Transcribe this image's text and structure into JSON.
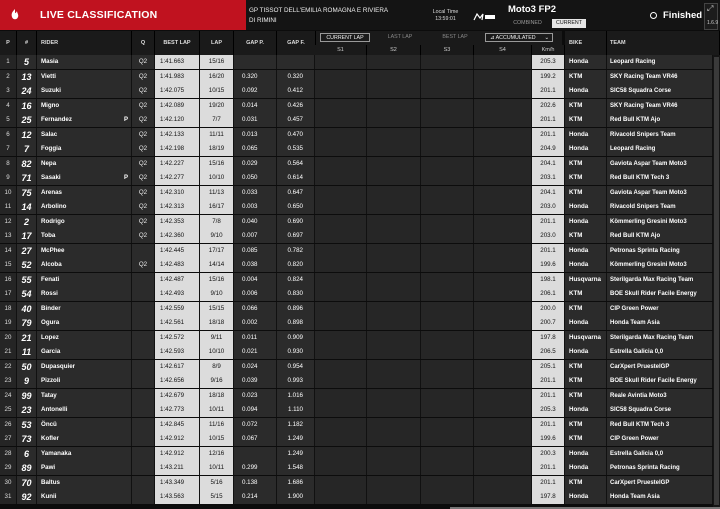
{
  "header": {
    "title": "LIVE CLASSIFICATION",
    "event": "GP TISSOT DELL'EMILIA ROMAGNA E RIVIERA DI RIMINI",
    "local_time_label": "Local Time",
    "local_time": "13:59:01",
    "class_name": "Moto3 FP2",
    "tab_combined": "COMBINED",
    "tab_current": "CURRENT",
    "status": "Finished",
    "version": "1.6.9",
    "colors": {
      "accent": "#c0121f"
    }
  },
  "columns": {
    "pos": "P",
    "num": "#",
    "rider": "RIDER",
    "q": "Q",
    "best_lap": "BEST LAP",
    "lap": "LAP",
    "gap_p": "GAP P.",
    "gap_f": "GAP F.",
    "s1": "S1",
    "s2": "S2",
    "s3": "S3",
    "s4": "S4",
    "speed": "Km/h",
    "bike": "BIKE",
    "team": "TEAM"
  },
  "sector_tabs": {
    "current_lap": "CURRENT LAP",
    "last_lap": "LAST LAP",
    "best_lap": "BEST LAP",
    "accumulated": "ACCUMULATED"
  },
  "rows": [
    {
      "pos": "1",
      "num": "5",
      "rider": "Masia",
      "pit": "",
      "q": "Q2",
      "best": "1:41.663",
      "lap": "15/16",
      "gap_p": "",
      "gap_f": "",
      "spd": "205.3",
      "bike": "Honda",
      "team": "Leopard Racing"
    },
    {
      "pos": "2",
      "num": "13",
      "rider": "Vietti",
      "pit": "",
      "q": "Q2",
      "best": "1:41.983",
      "lap": "16/20",
      "gap_p": "0.320",
      "gap_f": "0.320",
      "spd": "199.2",
      "bike": "KTM",
      "team": "SKY Racing Team VR46"
    },
    {
      "pos": "3",
      "num": "24",
      "rider": "Suzuki",
      "pit": "",
      "q": "Q2",
      "best": "1:42.075",
      "lap": "10/15",
      "gap_p": "0.092",
      "gap_f": "0.412",
      "spd": "201.1",
      "bike": "Honda",
      "team": "SIC58 Squadra Corse"
    },
    {
      "pos": "4",
      "num": "16",
      "rider": "Migno",
      "pit": "",
      "q": "Q2",
      "best": "1:42.089",
      "lap": "19/20",
      "gap_p": "0.014",
      "gap_f": "0.426",
      "spd": "202.6",
      "bike": "KTM",
      "team": "SKY Racing Team VR46"
    },
    {
      "pos": "5",
      "num": "25",
      "rider": "Fernandez",
      "pit": "P",
      "q": "Q2",
      "best": "1:42.120",
      "lap": "7/7",
      "gap_p": "0.031",
      "gap_f": "0.457",
      "spd": "201.1",
      "bike": "KTM",
      "team": "Red Bull KTM Ajo"
    },
    {
      "pos": "6",
      "num": "12",
      "rider": "Salac",
      "pit": "",
      "q": "Q2",
      "best": "1:42.133",
      "lap": "11/11",
      "gap_p": "0.013",
      "gap_f": "0.470",
      "spd": "201.1",
      "bike": "Honda",
      "team": "Rivacold Snipers Team"
    },
    {
      "pos": "7",
      "num": "7",
      "rider": "Foggia",
      "pit": "",
      "q": "Q2",
      "best": "1:42.198",
      "lap": "18/19",
      "gap_p": "0.065",
      "gap_f": "0.535",
      "spd": "204.9",
      "bike": "Honda",
      "team": "Leopard Racing"
    },
    {
      "pos": "8",
      "num": "82",
      "rider": "Nepa",
      "pit": "",
      "q": "Q2",
      "best": "1:42.227",
      "lap": "15/16",
      "gap_p": "0.029",
      "gap_f": "0.564",
      "spd": "204.1",
      "bike": "KTM",
      "team": "Gaviota Aspar Team Moto3"
    },
    {
      "pos": "9",
      "num": "71",
      "rider": "Sasaki",
      "pit": "P",
      "q": "Q2",
      "best": "1:42.277",
      "lap": "10/10",
      "gap_p": "0.050",
      "gap_f": "0.614",
      "spd": "203.1",
      "bike": "KTM",
      "team": "Red Bull KTM Tech 3"
    },
    {
      "pos": "10",
      "num": "75",
      "rider": "Arenas",
      "pit": "",
      "q": "Q2",
      "best": "1:42.310",
      "lap": "11/13",
      "gap_p": "0.033",
      "gap_f": "0.647",
      "spd": "204.1",
      "bike": "KTM",
      "team": "Gaviota Aspar Team Moto3"
    },
    {
      "pos": "11",
      "num": "14",
      "rider": "Arbolino",
      "pit": "",
      "q": "Q2",
      "best": "1:42.313",
      "lap": "16/17",
      "gap_p": "0.003",
      "gap_f": "0.650",
      "spd": "203.0",
      "bike": "Honda",
      "team": "Rivacold Snipers Team"
    },
    {
      "pos": "12",
      "num": "2",
      "rider": "Rodrigo",
      "pit": "",
      "q": "Q2",
      "best": "1:42.353",
      "lap": "7/8",
      "gap_p": "0.040",
      "gap_f": "0.690",
      "spd": "201.1",
      "bike": "Honda",
      "team": "Kömmerling Gresini Moto3"
    },
    {
      "pos": "13",
      "num": "17",
      "rider": "Toba",
      "pit": "",
      "q": "Q2",
      "best": "1:42.360",
      "lap": "9/10",
      "gap_p": "0.007",
      "gap_f": "0.697",
      "spd": "203.0",
      "bike": "KTM",
      "team": "Red Bull KTM Ajo"
    },
    {
      "pos": "14",
      "num": "27",
      "rider": "McPhee",
      "pit": "",
      "q": "",
      "best": "1:42.445",
      "lap": "17/17",
      "gap_p": "0.085",
      "gap_f": "0.782",
      "spd": "201.1",
      "bike": "Honda",
      "team": "Petronas Sprinta Racing"
    },
    {
      "pos": "15",
      "num": "52",
      "rider": "Alcoba",
      "pit": "",
      "q": "Q2",
      "best": "1:42.483",
      "lap": "14/14",
      "gap_p": "0.038",
      "gap_f": "0.820",
      "spd": "199.6",
      "bike": "Honda",
      "team": "Kömmerling Gresini Moto3"
    },
    {
      "pos": "16",
      "num": "55",
      "rider": "Fenati",
      "pit": "",
      "q": "",
      "best": "1:42.487",
      "lap": "15/16",
      "gap_p": "0.004",
      "gap_f": "0.824",
      "spd": "198.1",
      "bike": "Husqvarna",
      "team": "Sterilgarda Max Racing Team"
    },
    {
      "pos": "17",
      "num": "54",
      "rider": "Rossi",
      "pit": "",
      "q": "",
      "best": "1:42.493",
      "lap": "9/10",
      "gap_p": "0.006",
      "gap_f": "0.830",
      "spd": "206.1",
      "bike": "KTM",
      "team": "BOE Skull Rider Facile Energy"
    },
    {
      "pos": "18",
      "num": "40",
      "rider": "Binder",
      "pit": "",
      "q": "",
      "best": "1:42.559",
      "lap": "15/15",
      "gap_p": "0.066",
      "gap_f": "0.896",
      "spd": "200.0",
      "bike": "KTM",
      "team": "CIP Green Power"
    },
    {
      "pos": "19",
      "num": "79",
      "rider": "Ogura",
      "pit": "",
      "q": "",
      "best": "1:42.561",
      "lap": "18/18",
      "gap_p": "0.002",
      "gap_f": "0.898",
      "spd": "200.7",
      "bike": "Honda",
      "team": "Honda Team Asia"
    },
    {
      "pos": "20",
      "num": "21",
      "rider": "Lopez",
      "pit": "",
      "q": "",
      "best": "1:42.572",
      "lap": "9/11",
      "gap_p": "0.011",
      "gap_f": "0.909",
      "spd": "197.8",
      "bike": "Husqvarna",
      "team": "Sterilgarda Max Racing Team"
    },
    {
      "pos": "21",
      "num": "11",
      "rider": "Garcia",
      "pit": "",
      "q": "",
      "best": "1:42.593",
      "lap": "10/10",
      "gap_p": "0.021",
      "gap_f": "0.930",
      "spd": "206.5",
      "bike": "Honda",
      "team": "Estrella Galicia 0,0"
    },
    {
      "pos": "22",
      "num": "50",
      "rider": "Dupasquier",
      "pit": "",
      "q": "",
      "best": "1:42.617",
      "lap": "8/9",
      "gap_p": "0.024",
      "gap_f": "0.954",
      "spd": "205.1",
      "bike": "KTM",
      "team": "CarXpert PruestelGP"
    },
    {
      "pos": "23",
      "num": "9",
      "rider": "Pizzoli",
      "pit": "",
      "q": "",
      "best": "1:42.656",
      "lap": "9/16",
      "gap_p": "0.039",
      "gap_f": "0.993",
      "spd": "201.1",
      "bike": "KTM",
      "team": "BOE Skull Rider Facile Energy"
    },
    {
      "pos": "24",
      "num": "99",
      "rider": "Tatay",
      "pit": "",
      "q": "",
      "best": "1:42.679",
      "lap": "18/18",
      "gap_p": "0.023",
      "gap_f": "1.016",
      "spd": "201.1",
      "bike": "KTM",
      "team": "Reale Avintia Moto3"
    },
    {
      "pos": "25",
      "num": "23",
      "rider": "Antonelli",
      "pit": "",
      "q": "",
      "best": "1:42.773",
      "lap": "10/11",
      "gap_p": "0.094",
      "gap_f": "1.110",
      "spd": "205.3",
      "bike": "Honda",
      "team": "SIC58 Squadra Corse"
    },
    {
      "pos": "26",
      "num": "53",
      "rider": "Öncü",
      "pit": "",
      "q": "",
      "best": "1:42.845",
      "lap": "11/16",
      "gap_p": "0.072",
      "gap_f": "1.182",
      "spd": "201.1",
      "bike": "KTM",
      "team": "Red Bull KTM Tech 3"
    },
    {
      "pos": "27",
      "num": "73",
      "rider": "Kofler",
      "pit": "",
      "q": "",
      "best": "1:42.912",
      "lap": "10/15",
      "gap_p": "0.067",
      "gap_f": "1.249",
      "spd": "199.6",
      "bike": "KTM",
      "team": "CIP Green Power"
    },
    {
      "pos": "28",
      "num": "6",
      "rider": "Yamanaka",
      "pit": "",
      "q": "",
      "best": "1:42.912",
      "lap": "12/16",
      "gap_p": "",
      "gap_f": "1.249",
      "spd": "200.3",
      "bike": "Honda",
      "team": "Estrella Galicia 0,0"
    },
    {
      "pos": "29",
      "num": "89",
      "rider": "Pawi",
      "pit": "",
      "q": "",
      "best": "1:43.211",
      "lap": "10/11",
      "gap_p": "0.299",
      "gap_f": "1.548",
      "spd": "201.1",
      "bike": "Honda",
      "team": "Petronas Sprinta Racing"
    },
    {
      "pos": "30",
      "num": "70",
      "rider": "Baltus",
      "pit": "",
      "q": "",
      "best": "1:43.349",
      "lap": "5/16",
      "gap_p": "0.138",
      "gap_f": "1.686",
      "spd": "201.1",
      "bike": "KTM",
      "team": "CarXpert PruestelGP"
    },
    {
      "pos": "31",
      "num": "92",
      "rider": "Kunii",
      "pit": "",
      "q": "",
      "best": "1:43.563",
      "lap": "5/15",
      "gap_p": "0.214",
      "gap_f": "1.900",
      "spd": "197.8",
      "bike": "Honda",
      "team": "Honda Team Asia"
    }
  ]
}
